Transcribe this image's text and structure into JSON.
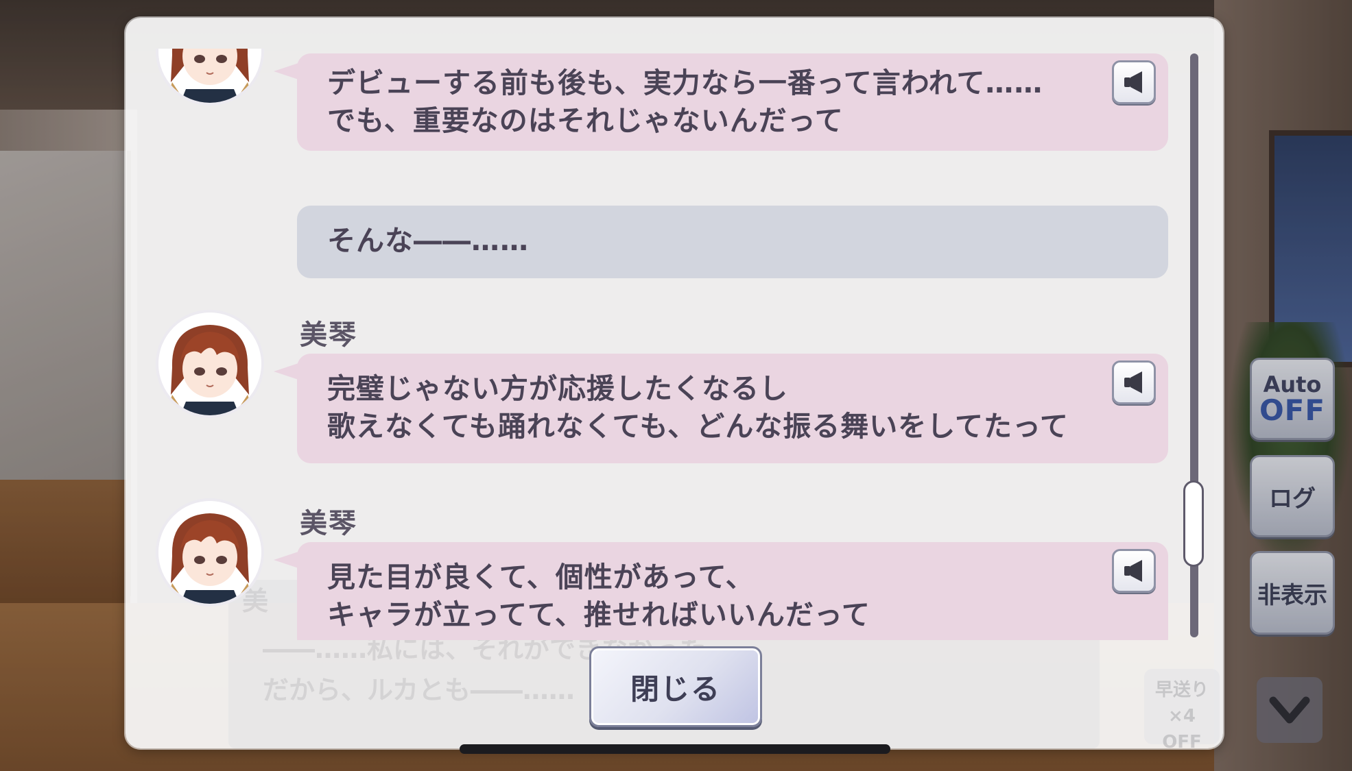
{
  "log": {
    "entries": [
      {
        "speaker": "",
        "has_avatar": true,
        "lines": [
          "デビューする前も後も、実力なら一番って言われて……",
          "でも、重要なのはそれじゃないんだって"
        ]
      },
      {
        "speaker": "",
        "has_avatar": false,
        "lines": [
          "そんな――……"
        ]
      },
      {
        "speaker": "美琴",
        "has_avatar": true,
        "lines": [
          "完璧じゃない方が応援したくなるし",
          "歌えなくても踊れなくても、どんな振る舞いをしてたって"
        ]
      },
      {
        "speaker": "美琴",
        "has_avatar": true,
        "lines": [
          "見た目が良くて、個性があって、",
          "キャラが立ってて、推せればいいんだって"
        ]
      }
    ],
    "close_label": "閉じる",
    "background_text": {
      "name": "美",
      "line1": "――……私には、それができなかった",
      "line2": "だから、ルカとも――……",
      "speed_line1": "早送り×4",
      "speed_line2": "OFF"
    }
  },
  "controls": {
    "auto_label": "Auto",
    "auto_state": "OFF",
    "log_label": "ログ",
    "hide_label": "非表示"
  },
  "icons": {
    "voice": "speaker-icon",
    "down": "chevron-down-icon"
  },
  "colors": {
    "bubble_pink": "#ead5e1",
    "bubble_grey": "#d2d5de",
    "text": "#4a4356",
    "auto_off": "#3656a8"
  }
}
